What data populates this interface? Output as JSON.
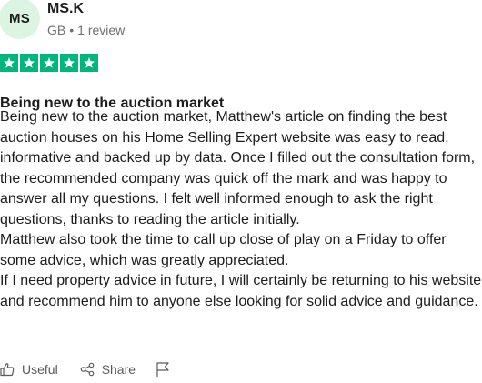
{
  "reviewer": {
    "initials": "MS",
    "name": "MS.K",
    "country": "GB",
    "separator": "•",
    "review_count": "1 review"
  },
  "rating": {
    "stars": 5,
    "max": 5,
    "star_color": "#00b67a"
  },
  "review": {
    "title": "Being new to the auction market",
    "paragraphs": [
      "Being new to the auction market, Matthew's article on finding the best auction houses on his Home Selling Expert website was easy to read, informative and backed up by data. Once I filled out the consultation form, the recommended company was quick off the mark and was happy to answer all my questions. I felt well informed enough to ask the right questions, thanks to reading the article initially.",
      "Matthew also took the time to call up close of play on a Friday to offer some advice, which was greatly appreciated.",
      "If I need property advice in future, I will certainly be returning to his website and recommend him to anyone else looking for solid advice and guidance."
    ]
  },
  "actions": {
    "useful_label": "Useful",
    "useful_icon": "thumbs-up-icon",
    "share_label": "Share",
    "share_icon": "share-icon",
    "flag_icon": "flag-icon"
  },
  "colors": {
    "avatar_bg": "#dcf5e3",
    "text": "#1c1c1c",
    "muted": "#6f6f6f"
  }
}
